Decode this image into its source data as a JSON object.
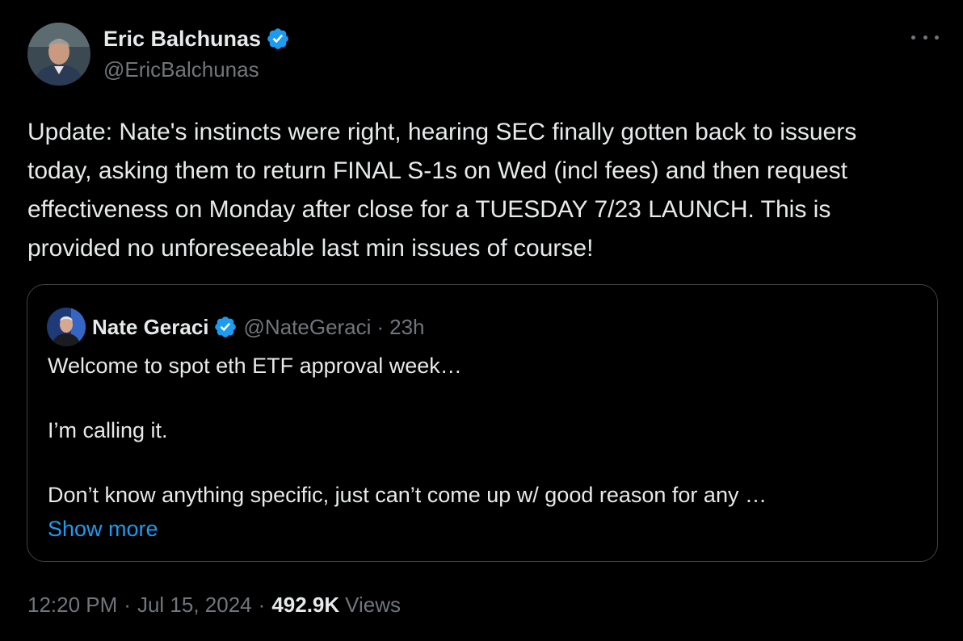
{
  "author": {
    "display_name": "Eric Balchunas",
    "handle": "@EricBalchunas",
    "verified_color": "#1d9bf0",
    "avatar_icon": "avatar-photo-icon"
  },
  "menu": {
    "more_icon": "more-options-icon"
  },
  "tweet": {
    "text": "Update: Nate's instincts were right, hearing SEC finally gotten back to issuers today, asking them to return FINAL S-1s on Wed (incl fees) and then request effectiveness on Monday after close for a TUESDAY 7/23 LAUNCH. This is provided no unforeseeable last min issues of course!"
  },
  "quoted": {
    "display_name": "Nate Geraci",
    "handle": "@NateGeraci",
    "separator": "·",
    "time": "23h",
    "text": "Welcome to spot eth ETF approval week…\n\nI’m calling it.\n\nDon’t know anything specific, just can’t come up w/ good reason for any …",
    "show_more": "Show more"
  },
  "meta": {
    "time": "12:20 PM",
    "separator": "·",
    "date": "Jul 15, 2024",
    "views_count": "492.9K",
    "views_label": "Views"
  },
  "colors": {
    "background": "#000000",
    "text": "#e7e9ea",
    "secondary": "#71767b",
    "link": "#1d9bf0",
    "border": "#3e4144"
  }
}
